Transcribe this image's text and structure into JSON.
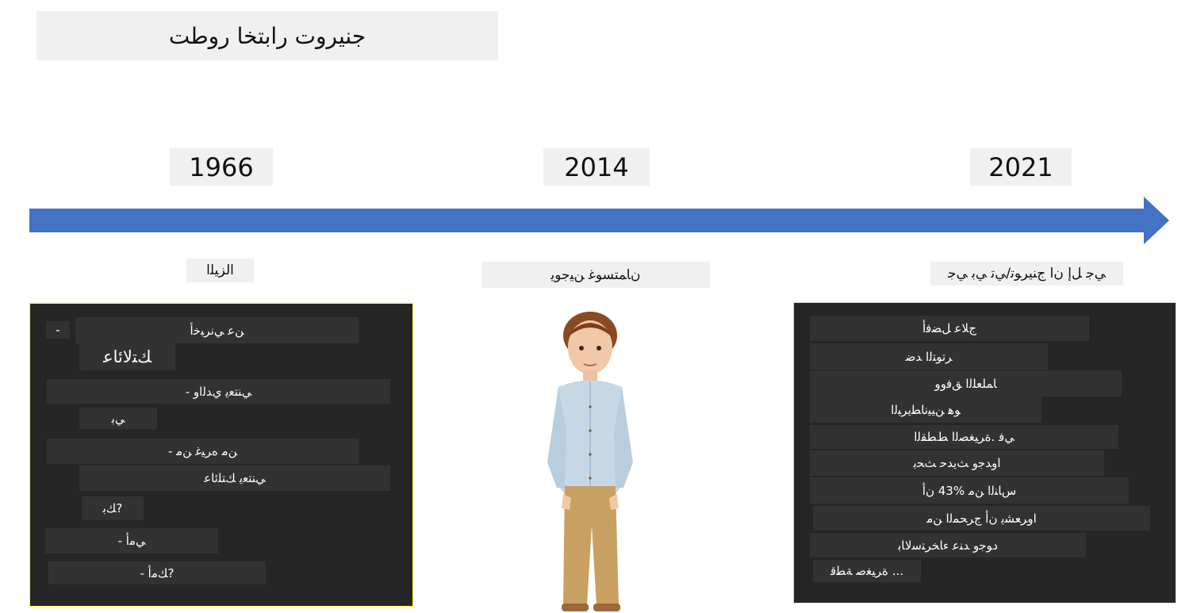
{
  "title": "جنيروت رابتخا روطت",
  "years": [
    "1966",
    "2014",
    "2021"
  ],
  "labels": {
    "left": "اﻟﺰﻴﻠا",
    "center": "نﺎﻤﺘﺴﻮﻏ ﻦﻴﺟﻮﻳ",
    "right": "ﻲﺟ ﻞﺇ ﻥﺍ ﺝﻨﻴﺮﻮﺗ/ﻲﺗ ﻲﺑ ﻲﺟ"
  },
  "left_panel": [
    "-",
    "ﻦﻋ ﻲﻧﺮﺒﺧﺃ",
    "ﻚﺘﻟﺎﺋﺎﻋ",
    "ﻲﻨﺘﻌﻳ ﻱﺪﻟﺍﻭ -",
    "ﻲﺑ",
    "ﻦﻣ ﻩﺮﻴﻏ ﻦﻣ -",
    "ﻲﻨﺘﻌﻳ ﻚﺘﻠﺋﺎﻋ",
    "?ﻚﺑ",
    "ﻲﻣﺃ -",
    "?ﻚﻣﺃ -"
  ],
  "right_panel": [
    "ﺝﻼﻋ ﻞﻀﻓﺃ",
    "ﺮﺗﻮﺘﻟﺍ ﺪﺿ",
    "ﺎﻤﻠﻌﻠﻟﺍ ﻖﻓﻭﻭ",
    "ﻮﻫ ﻦﻴﻴﻧﺎﻄﻳﺮﺒﻟﺍ",
    "ﻲﻓ .ﺓﺮﻴﻐﺼﻟﺍ ﻂﻄﻘﻟﺍ",
    "ﺍﻭﺪﺟﻭ ﺚﻳﺪﺣ ﺚﺤﺑ",
    "ﺱﺎﻨﻟﺍ ﻦﻣ %43 ﻥﺃ",
    "ﺍﻭﺮﻌﺸﻳ ﻥﺃ ﺝﺮﺤﻤﻟﺍ ﻦﻣ",
    "ﺩﻮﺟﻭ ﺪﻨﻋ ﺀﺎﺨﺮﺘﺳﻻﺎﺑ",
    "... ﺓﺮﻴﻐﺻ ﺔﻄﻗ"
  ],
  "colors": {
    "arrow": "#4472c4",
    "panel": "#262626",
    "label_bg": "#f0f0f0"
  }
}
